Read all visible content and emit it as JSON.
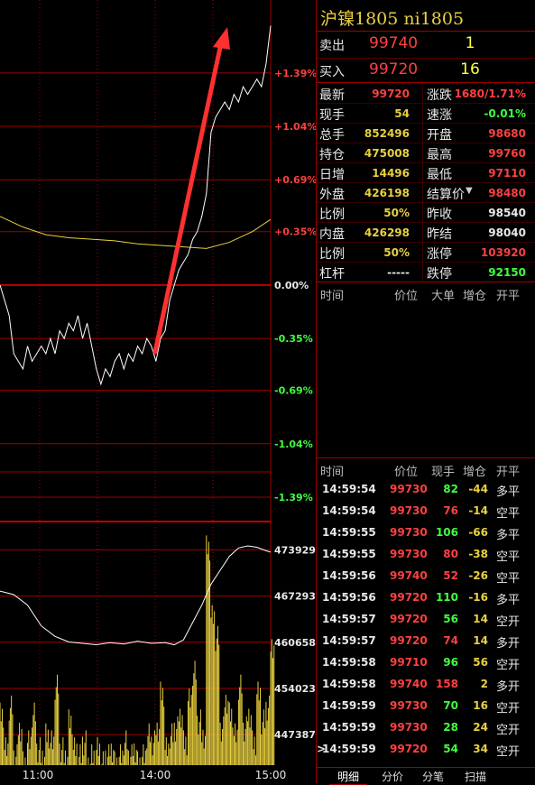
{
  "colors": {
    "up": "#ff4040",
    "down": "#40ff40",
    "neutral": "#e8e8e8",
    "volume": "#e8d040",
    "grid": "#a00000",
    "price_line": "#ffffff",
    "avg_line": "#e8d040",
    "arrow": "#ff3030"
  },
  "header": {
    "title": "沪镍1805 ni1805"
  },
  "quote": {
    "sell_label": "卖出",
    "sell_price": "99740",
    "sell_vol": "1",
    "buy_label": "买入",
    "buy_price": "99720",
    "buy_vol": "16"
  },
  "stats": [
    {
      "l1": "最新",
      "v1": "99720",
      "c1": "up",
      "l2": "涨跌",
      "v2": "1680/1.71%",
      "c2": "up",
      "l2icon": ""
    },
    {
      "l1": "现手",
      "v1": "54",
      "c1": "vol",
      "l2": "速涨",
      "v2": "-0.01%",
      "c2": "down",
      "l2icon": ""
    },
    {
      "l1": "总手",
      "v1": "852496",
      "c1": "vol",
      "l2": "开盘",
      "v2": "98680",
      "c2": "up",
      "l2icon": ""
    },
    {
      "l1": "持仓",
      "v1": "475008",
      "c1": "vol",
      "l2": "最高",
      "v2": "99760",
      "c2": "up",
      "l2icon": ""
    },
    {
      "l1": "日增",
      "v1": "14496",
      "c1": "vol",
      "l2": "最低",
      "v2": "97110",
      "c2": "up",
      "l2icon": ""
    },
    {
      "l1": "外盘",
      "v1": "426198",
      "c1": "vol",
      "l2": "结算价",
      "v2": "98480",
      "c2": "up",
      "l2icon": "caret-down-icon"
    },
    {
      "l1": "比例",
      "v1": "50%",
      "c1": "vol",
      "l2": "昨收",
      "v2": "98540",
      "c2": "neutral",
      "l2icon": ""
    },
    {
      "l1": "内盘",
      "v1": "426298",
      "c1": "vol",
      "l2": "昨结",
      "v2": "98040",
      "c2": "neutral",
      "l2icon": ""
    },
    {
      "l1": "比例",
      "v1": "50%",
      "c1": "vol",
      "l2": "涨停",
      "v2": "103920",
      "c2": "up",
      "l2icon": ""
    },
    {
      "l1": "杠杆",
      "v1": "-----",
      "c1": "neutral",
      "l2": "跌停",
      "v2": "92150",
      "c2": "down",
      "l2icon": ""
    }
  ],
  "big_orders": {
    "headers": [
      "时间",
      "价位",
      "大单",
      "增仓",
      "开平"
    ]
  },
  "ticks": {
    "headers": [
      "时间",
      "价位",
      "现手",
      "增仓",
      "开平"
    ],
    "rows": [
      {
        "time": "14:59:54",
        "price": "99730",
        "pc": "up",
        "vol": "82",
        "vc": "down",
        "chg": "-44",
        "cc": "vol",
        "type": "多平",
        "mark": ""
      },
      {
        "time": "14:59:54",
        "price": "99730",
        "pc": "up",
        "vol": "76",
        "vc": "up",
        "chg": "-14",
        "cc": "vol",
        "type": "空平",
        "mark": ""
      },
      {
        "time": "14:59:55",
        "price": "99730",
        "pc": "up",
        "vol": "106",
        "vc": "down",
        "chg": "-66",
        "cc": "vol",
        "type": "多平",
        "mark": ""
      },
      {
        "time": "14:59:55",
        "price": "99730",
        "pc": "up",
        "vol": "80",
        "vc": "up",
        "chg": "-38",
        "cc": "vol",
        "type": "空平",
        "mark": ""
      },
      {
        "time": "14:59:56",
        "price": "99740",
        "pc": "up",
        "vol": "52",
        "vc": "up",
        "chg": "-26",
        "cc": "vol",
        "type": "空平",
        "mark": ""
      },
      {
        "time": "14:59:56",
        "price": "99720",
        "pc": "up",
        "vol": "110",
        "vc": "down",
        "chg": "-16",
        "cc": "vol",
        "type": "多平",
        "mark": ""
      },
      {
        "time": "14:59:57",
        "price": "99720",
        "pc": "up",
        "vol": "56",
        "vc": "down",
        "chg": "14",
        "cc": "vol",
        "type": "空开",
        "mark": ""
      },
      {
        "time": "14:59:57",
        "price": "99720",
        "pc": "up",
        "vol": "74",
        "vc": "up",
        "chg": "14",
        "cc": "vol",
        "type": "多开",
        "mark": ""
      },
      {
        "time": "14:59:58",
        "price": "99710",
        "pc": "up",
        "vol": "96",
        "vc": "down",
        "chg": "56",
        "cc": "vol",
        "type": "空开",
        "mark": ""
      },
      {
        "time": "14:59:58",
        "price": "99740",
        "pc": "up",
        "vol": "158",
        "vc": "up",
        "chg": "2",
        "cc": "vol",
        "type": "多开",
        "mark": ""
      },
      {
        "time": "14:59:59",
        "price": "99730",
        "pc": "up",
        "vol": "70",
        "vc": "down",
        "chg": "16",
        "cc": "vol",
        "type": "空开",
        "mark": ""
      },
      {
        "time": "14:59:59",
        "price": "99730",
        "pc": "up",
        "vol": "28",
        "vc": "down",
        "chg": "24",
        "cc": "vol",
        "type": "空开",
        "mark": ""
      },
      {
        "time": "14:59:59",
        "price": "99720",
        "pc": "up",
        "vol": "54",
        "vc": "down",
        "chg": "34",
        "cc": "vol",
        "type": "空开",
        "mark": ">"
      }
    ]
  },
  "tabs": [
    {
      "label": "明细",
      "selected": true
    },
    {
      "label": "分价",
      "selected": false
    },
    {
      "label": "分笔",
      "selected": false
    },
    {
      "label": "扫描",
      "selected": false
    }
  ],
  "chart_data": {
    "type": "line",
    "price_axis": {
      "labels": [
        "+1.39%",
        "+1.04%",
        "+0.69%",
        "+0.35%",
        "0.00%",
        "-0.35%",
        "-0.69%",
        "-1.04%",
        "-1.39%"
      ],
      "values": [
        1.39,
        1.04,
        0.69,
        0.35,
        0.0,
        -0.35,
        -0.69,
        -1.04,
        -1.39
      ],
      "range": [
        -1.55,
        1.75
      ]
    },
    "volume_axis": {
      "labels": [
        "473929",
        "467293",
        "460658",
        "454023",
        "447387"
      ],
      "values": [
        473929,
        467293,
        460658,
        454023,
        447387
      ],
      "range": [
        443000,
        478000
      ]
    },
    "x_labels": [
      "11:00",
      "14:00",
      "15:00"
    ],
    "series": [
      {
        "role": "price",
        "x": [
          0,
          1,
          2,
          3,
          4,
          5,
          6,
          7,
          8,
          9,
          10,
          11,
          12,
          13,
          14,
          15,
          16,
          17,
          18,
          19,
          20,
          21,
          22,
          23,
          24,
          25,
          26,
          27,
          28,
          29,
          30,
          31,
          32,
          33,
          34,
          35,
          36,
          37,
          38,
          39,
          40,
          41,
          42,
          43,
          44,
          45,
          46,
          47,
          48,
          49,
          50,
          51,
          52,
          53,
          54,
          55,
          56,
          57,
          58,
          59
        ],
        "values": [
          0.0,
          -0.1,
          -0.2,
          -0.45,
          -0.5,
          -0.55,
          -0.4,
          -0.5,
          -0.45,
          -0.4,
          -0.45,
          -0.35,
          -0.45,
          -0.3,
          -0.35,
          -0.25,
          -0.3,
          -0.2,
          -0.35,
          -0.25,
          -0.4,
          -0.55,
          -0.65,
          -0.55,
          -0.6,
          -0.5,
          -0.45,
          -0.55,
          -0.45,
          -0.5,
          -0.4,
          -0.45,
          -0.35,
          -0.4,
          -0.5,
          -0.35,
          -0.3,
          -0.1,
          0.0,
          0.1,
          0.15,
          0.2,
          0.3,
          0.35,
          0.45,
          0.6,
          1.0,
          1.1,
          1.15,
          1.2,
          1.15,
          1.25,
          1.2,
          1.3,
          1.25,
          1.3,
          1.35,
          1.3,
          1.45,
          1.7
        ]
      },
      {
        "role": "average",
        "x": [
          0,
          5,
          10,
          15,
          20,
          25,
          30,
          35,
          40,
          45,
          50,
          55,
          59
        ],
        "values": [
          0.45,
          0.38,
          0.33,
          0.31,
          0.3,
          0.29,
          0.27,
          0.26,
          0.25,
          0.24,
          0.28,
          0.35,
          0.43
        ]
      },
      {
        "role": "open_interest",
        "x": [
          0,
          3,
          6,
          9,
          12,
          15,
          18,
          21,
          24,
          27,
          30,
          33,
          36,
          38,
          40,
          42,
          44,
          46,
          48,
          50,
          52,
          54,
          56,
          58,
          59
        ],
        "values": [
          468000,
          467500,
          466000,
          463000,
          461500,
          460700,
          460500,
          460300,
          460600,
          460400,
          460800,
          460500,
          460600,
          460300,
          461000,
          463500,
          466000,
          469000,
          471000,
          473000,
          474200,
          474500,
          474300,
          473800,
          473600
        ]
      },
      {
        "role": "volume",
        "x": [
          0,
          1,
          2,
          3,
          4,
          5,
          6,
          7,
          8,
          9,
          10,
          11,
          12,
          13,
          14,
          15,
          16,
          17,
          18,
          19,
          20,
          21,
          22,
          23,
          24,
          25,
          26,
          27,
          28,
          29,
          30,
          31,
          32,
          33,
          34,
          35,
          36,
          37,
          38,
          39,
          40,
          41,
          42,
          43,
          44,
          45,
          46,
          47,
          48,
          49,
          50,
          51,
          52,
          53,
          54,
          55,
          56,
          57,
          58,
          59
        ],
        "values": [
          452000,
          447000,
          453000,
          446000,
          450000,
          445000,
          448000,
          452000,
          447000,
          446000,
          449000,
          448000,
          456000,
          447000,
          446000,
          451000,
          447000,
          446000,
          448000,
          445000,
          446000,
          447000,
          445000,
          446000,
          447000,
          445000,
          446000,
          448000,
          446000,
          447000,
          445000,
          446000,
          449000,
          448000,
          450000,
          455000,
          447000,
          449000,
          450000,
          452000,
          448000,
          454000,
          458000,
          451000,
          449000,
          476000,
          466000,
          463000,
          450000,
          454000,
          452000,
          449000,
          456000,
          450000,
          452000,
          448000,
          455000,
          451000,
          453000,
          462000
        ]
      }
    ],
    "annotation": "arrow-up"
  }
}
